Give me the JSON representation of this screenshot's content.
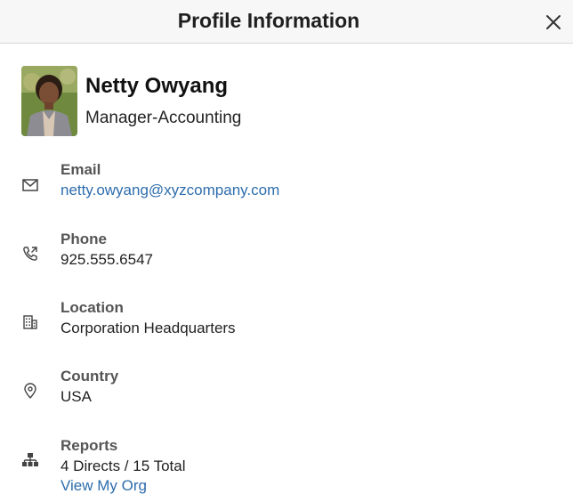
{
  "header": {
    "title": "Profile Information",
    "close_icon": "close-icon"
  },
  "profile": {
    "name": "Netty Owyang",
    "job_title": "Manager-Accounting"
  },
  "details": {
    "email": {
      "label": "Email",
      "value": "netty.owyang@xyzcompany.com",
      "icon": "mail-icon"
    },
    "phone": {
      "label": "Phone",
      "value": "925.555.6547",
      "icon": "phone-icon"
    },
    "location": {
      "label": "Location",
      "value": "Corporation Headquarters",
      "icon": "building-icon"
    },
    "country": {
      "label": "Country",
      "value": "USA",
      "icon": "map-pin-icon"
    },
    "reports": {
      "label": "Reports",
      "value": "4 Directs / 15 Total",
      "link": "View My Org",
      "icon": "org-chart-icon"
    }
  },
  "colors": {
    "link": "#2e6dac",
    "label": "#555555",
    "header_bg": "#f7f7f7"
  }
}
